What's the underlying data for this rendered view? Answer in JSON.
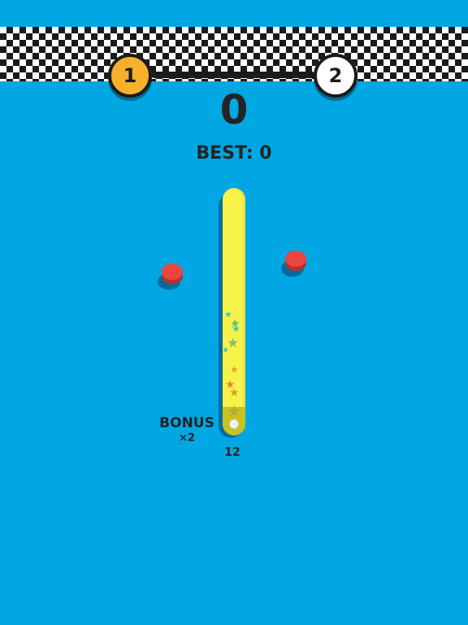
{
  "progress": {
    "current_level": "1",
    "next_level": "2",
    "fraction": 0
  },
  "score": "0",
  "best": "BEST: 0",
  "bonus": {
    "label": "BONUS",
    "multiplier": "×2"
  },
  "tube": {
    "count": "12"
  },
  "icons": [
    "finish-flag-checker",
    "star-sparkle",
    "ball",
    "red-obstacle"
  ],
  "colors": {
    "background": "#00a7e3",
    "current_level_badge": "#f7b02b",
    "next_level_badge": "#ffffff",
    "tube": "#f7f24a",
    "obstacle": "#e8463f",
    "text": "#242424"
  }
}
